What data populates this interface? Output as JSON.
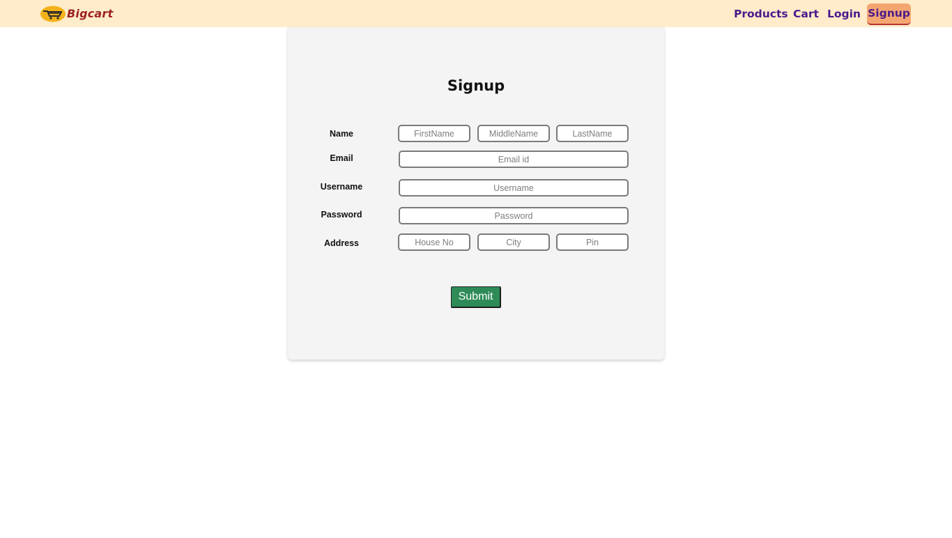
{
  "brand": {
    "name": "Bigcart",
    "logo_icon": "cart-logo-icon"
  },
  "nav": {
    "products": "Products",
    "cart": "Cart",
    "login": "Login",
    "signup": "Signup"
  },
  "form": {
    "title": "Signup",
    "labels": {
      "name": "Name",
      "email": "Email",
      "username": "Username",
      "password": "Password",
      "address": "Address"
    },
    "placeholders": {
      "first_name": "FirstName",
      "middle_name": "MiddleName",
      "last_name": "LastName",
      "email": "Email id",
      "username": "Username",
      "password": "Password",
      "house_no": "House No",
      "city": "City",
      "pin": "Pin"
    },
    "submit_label": "Submit"
  },
  "colors": {
    "navbar_bg": "#ffecca",
    "nav_text": "#4a1a8c",
    "active_nav_bg": "#f4a672",
    "brand_text": "#9c2222",
    "submit_bg": "#2e8b57"
  }
}
